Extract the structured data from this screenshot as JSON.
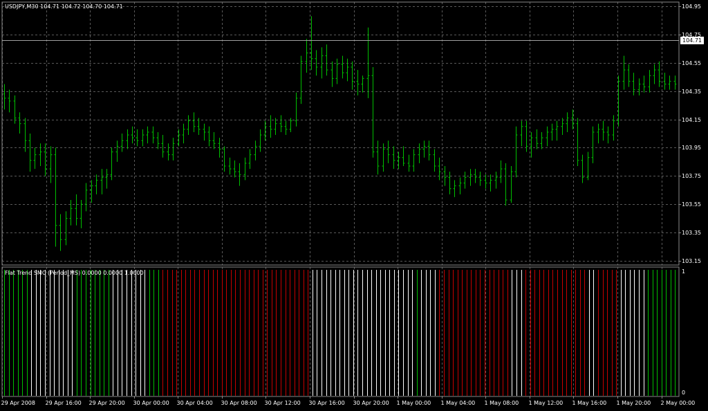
{
  "window": {
    "symbol_info": "USDJPY,M30  104.71 104.72 104.70 104.71",
    "current_price": "104.71"
  },
  "colors": {
    "background": "#000000",
    "grid": "#5a5a5a",
    "candle": "#00c000",
    "hist_green": "#00c000",
    "hist_white": "#ffffff",
    "hist_red": "#c80000",
    "axis": "#8a8a8a"
  },
  "price_axis": {
    "labels": [
      "104.95",
      "104.75",
      "104.55",
      "104.35",
      "104.15",
      "103.95",
      "103.75",
      "103.55",
      "103.35",
      "103.15"
    ],
    "ylim": [
      103.12,
      104.98
    ]
  },
  "time_axis": {
    "labels": [
      "29 Apr 2008",
      "29 Apr 16:00",
      "29 Apr 20:00",
      "30 Apr 00:00",
      "30 Apr 04:00",
      "30 Apr 08:00",
      "30 Apr 12:00",
      "30 Apr 16:00",
      "30 Apr 20:00",
      "1 May 00:00",
      "1 May 04:00",
      "1 May 08:00",
      "1 May 12:00",
      "1 May 16:00",
      "1 May 20:00",
      "2 May 00:00"
    ]
  },
  "indicator": {
    "label": "Flat Trend SMC (Period_MS) 0.0000 0.0000 1.0000",
    "scale_top": "1",
    "scale_bottom": "0",
    "segments": [
      {
        "color": "green",
        "count": 6
      },
      {
        "color": "white",
        "count": 10
      },
      {
        "color": "green",
        "count": 8
      },
      {
        "color": "white",
        "count": 8
      },
      {
        "color": "green",
        "count": 3
      },
      {
        "color": "red",
        "count": 33
      },
      {
        "color": "white",
        "count": 23
      },
      {
        "color": "green",
        "count": 1
      },
      {
        "color": "white",
        "count": 4
      },
      {
        "color": "red",
        "count": 16
      },
      {
        "color": "white",
        "count": 3
      },
      {
        "color": "red",
        "count": 14
      },
      {
        "color": "white",
        "count": 2
      },
      {
        "color": "red",
        "count": 5
      },
      {
        "color": "white",
        "count": 6
      },
      {
        "color": "green",
        "count": 7
      }
    ]
  },
  "chart_data": {
    "type": "ohlc",
    "title": "USDJPY,M30",
    "ylim": [
      103.12,
      104.98
    ],
    "bars": [
      {
        "o": 104.33,
        "h": 104.4,
        "l": 104.22,
        "c": 104.3
      },
      {
        "o": 104.3,
        "h": 104.36,
        "l": 104.2,
        "c": 104.28
      },
      {
        "o": 104.28,
        "h": 104.32,
        "l": 104.12,
        "c": 104.16
      },
      {
        "o": 104.16,
        "h": 104.2,
        "l": 104.05,
        "c": 104.12
      },
      {
        "o": 104.12,
        "h": 104.16,
        "l": 103.92,
        "c": 104.0
      },
      {
        "o": 104.0,
        "h": 104.05,
        "l": 103.78,
        "c": 103.86
      },
      {
        "o": 103.86,
        "h": 103.95,
        "l": 103.8,
        "c": 103.9
      },
      {
        "o": 103.9,
        "h": 103.98,
        "l": 103.82,
        "c": 103.92
      },
      {
        "o": 103.92,
        "h": 103.98,
        "l": 103.75,
        "c": 103.8
      },
      {
        "o": 103.8,
        "h": 103.96,
        "l": 103.7,
        "c": 103.9
      },
      {
        "o": 103.9,
        "h": 103.95,
        "l": 103.25,
        "c": 103.4
      },
      {
        "o": 103.4,
        "h": 103.48,
        "l": 103.22,
        "c": 103.3
      },
      {
        "o": 103.3,
        "h": 103.5,
        "l": 103.26,
        "c": 103.45
      },
      {
        "o": 103.45,
        "h": 103.58,
        "l": 103.4,
        "c": 103.52
      },
      {
        "o": 103.52,
        "h": 103.62,
        "l": 103.4,
        "c": 103.45
      },
      {
        "o": 103.45,
        "h": 103.58,
        "l": 103.38,
        "c": 103.55
      },
      {
        "o": 103.55,
        "h": 103.7,
        "l": 103.5,
        "c": 103.65
      },
      {
        "o": 103.65,
        "h": 103.72,
        "l": 103.56,
        "c": 103.68
      },
      {
        "o": 103.68,
        "h": 103.76,
        "l": 103.62,
        "c": 103.72
      },
      {
        "o": 103.72,
        "h": 103.8,
        "l": 103.62,
        "c": 103.74
      },
      {
        "o": 103.74,
        "h": 103.8,
        "l": 103.66,
        "c": 103.76
      },
      {
        "o": 103.76,
        "h": 103.95,
        "l": 103.72,
        "c": 103.92
      },
      {
        "o": 103.92,
        "h": 104.0,
        "l": 103.85,
        "c": 103.96
      },
      {
        "o": 103.96,
        "h": 104.05,
        "l": 103.92,
        "c": 104.0
      },
      {
        "o": 104.0,
        "h": 104.08,
        "l": 103.94,
        "c": 104.04
      },
      {
        "o": 104.04,
        "h": 104.1,
        "l": 103.98,
        "c": 104.02
      },
      {
        "o": 104.02,
        "h": 104.08,
        "l": 103.96,
        "c": 104.0
      },
      {
        "o": 104.0,
        "h": 104.08,
        "l": 103.96,
        "c": 104.04
      },
      {
        "o": 104.04,
        "h": 104.1,
        "l": 103.98,
        "c": 104.06
      },
      {
        "o": 104.06,
        "h": 104.1,
        "l": 103.98,
        "c": 104.02
      },
      {
        "o": 104.02,
        "h": 104.06,
        "l": 103.94,
        "c": 103.98
      },
      {
        "o": 103.98,
        "h": 104.04,
        "l": 103.88,
        "c": 103.92
      },
      {
        "o": 103.92,
        "h": 103.98,
        "l": 103.86,
        "c": 103.9
      },
      {
        "o": 103.9,
        "h": 104.02,
        "l": 103.86,
        "c": 103.98
      },
      {
        "o": 103.98,
        "h": 104.08,
        "l": 103.96,
        "c": 104.04
      },
      {
        "o": 104.04,
        "h": 104.12,
        "l": 103.98,
        "c": 104.08
      },
      {
        "o": 104.08,
        "h": 104.18,
        "l": 104.04,
        "c": 104.14
      },
      {
        "o": 104.14,
        "h": 104.2,
        "l": 104.06,
        "c": 104.1
      },
      {
        "o": 104.1,
        "h": 104.16,
        "l": 104.04,
        "c": 104.08
      },
      {
        "o": 104.08,
        "h": 104.12,
        "l": 104.0,
        "c": 104.06
      },
      {
        "o": 104.06,
        "h": 104.1,
        "l": 103.96,
        "c": 104.0
      },
      {
        "o": 104.0,
        "h": 104.06,
        "l": 103.94,
        "c": 103.98
      },
      {
        "o": 103.98,
        "h": 104.02,
        "l": 103.88,
        "c": 103.94
      },
      {
        "o": 103.94,
        "h": 103.96,
        "l": 103.78,
        "c": 103.82
      },
      {
        "o": 103.82,
        "h": 103.88,
        "l": 103.76,
        "c": 103.8
      },
      {
        "o": 103.8,
        "h": 103.86,
        "l": 103.74,
        "c": 103.78
      },
      {
        "o": 103.78,
        "h": 103.84,
        "l": 103.68,
        "c": 103.76
      },
      {
        "o": 103.76,
        "h": 103.88,
        "l": 103.72,
        "c": 103.84
      },
      {
        "o": 103.84,
        "h": 103.94,
        "l": 103.8,
        "c": 103.9
      },
      {
        "o": 103.9,
        "h": 104.0,
        "l": 103.86,
        "c": 103.96
      },
      {
        "o": 103.96,
        "h": 104.08,
        "l": 103.92,
        "c": 104.04
      },
      {
        "o": 104.04,
        "h": 104.14,
        "l": 104.0,
        "c": 104.1
      },
      {
        "o": 104.1,
        "h": 104.18,
        "l": 104.02,
        "c": 104.08
      },
      {
        "o": 104.08,
        "h": 104.16,
        "l": 104.04,
        "c": 104.12
      },
      {
        "o": 104.12,
        "h": 104.18,
        "l": 104.06,
        "c": 104.1
      },
      {
        "o": 104.1,
        "h": 104.14,
        "l": 104.04,
        "c": 104.08
      },
      {
        "o": 104.08,
        "h": 104.16,
        "l": 104.06,
        "c": 104.14
      },
      {
        "o": 104.14,
        "h": 104.34,
        "l": 104.1,
        "c": 104.3
      },
      {
        "o": 104.3,
        "h": 104.6,
        "l": 104.26,
        "c": 104.56
      },
      {
        "o": 104.56,
        "h": 104.72,
        "l": 104.48,
        "c": 104.62
      },
      {
        "o": 104.62,
        "h": 104.88,
        "l": 104.5,
        "c": 104.58
      },
      {
        "o": 104.58,
        "h": 104.64,
        "l": 104.46,
        "c": 104.52
      },
      {
        "o": 104.52,
        "h": 104.66,
        "l": 104.44,
        "c": 104.6
      },
      {
        "o": 104.6,
        "h": 104.68,
        "l": 104.46,
        "c": 104.5
      },
      {
        "o": 104.5,
        "h": 104.56,
        "l": 104.38,
        "c": 104.44
      },
      {
        "o": 104.44,
        "h": 104.58,
        "l": 104.4,
        "c": 104.54
      },
      {
        "o": 104.54,
        "h": 104.6,
        "l": 104.44,
        "c": 104.48
      },
      {
        "o": 104.48,
        "h": 104.58,
        "l": 104.42,
        "c": 104.52
      },
      {
        "o": 104.52,
        "h": 104.56,
        "l": 104.36,
        "c": 104.42
      },
      {
        "o": 104.42,
        "h": 104.5,
        "l": 104.32,
        "c": 104.4
      },
      {
        "o": 104.4,
        "h": 104.46,
        "l": 104.34,
        "c": 104.44
      },
      {
        "o": 104.44,
        "h": 104.8,
        "l": 104.3,
        "c": 104.46
      },
      {
        "o": 104.46,
        "h": 104.52,
        "l": 103.88,
        "c": 103.92
      },
      {
        "o": 103.92,
        "h": 104.0,
        "l": 103.76,
        "c": 103.82
      },
      {
        "o": 103.82,
        "h": 103.98,
        "l": 103.78,
        "c": 103.94
      },
      {
        "o": 103.94,
        "h": 104.0,
        "l": 103.84,
        "c": 103.9
      },
      {
        "o": 103.9,
        "h": 103.96,
        "l": 103.8,
        "c": 103.86
      },
      {
        "o": 103.86,
        "h": 103.92,
        "l": 103.8,
        "c": 103.88
      },
      {
        "o": 103.88,
        "h": 103.96,
        "l": 103.82,
        "c": 103.84
      },
      {
        "o": 103.84,
        "h": 103.9,
        "l": 103.78,
        "c": 103.82
      },
      {
        "o": 103.82,
        "h": 103.94,
        "l": 103.78,
        "c": 103.9
      },
      {
        "o": 103.9,
        "h": 103.98,
        "l": 103.84,
        "c": 103.94
      },
      {
        "o": 103.94,
        "h": 104.0,
        "l": 103.88,
        "c": 103.96
      },
      {
        "o": 103.96,
        "h": 104.0,
        "l": 103.86,
        "c": 103.9
      },
      {
        "o": 103.9,
        "h": 103.94,
        "l": 103.78,
        "c": 103.82
      },
      {
        "o": 103.82,
        "h": 103.88,
        "l": 103.72,
        "c": 103.78
      },
      {
        "o": 103.78,
        "h": 103.82,
        "l": 103.68,
        "c": 103.74
      },
      {
        "o": 103.74,
        "h": 103.78,
        "l": 103.62,
        "c": 103.66
      },
      {
        "o": 103.66,
        "h": 103.72,
        "l": 103.6,
        "c": 103.68
      },
      {
        "o": 103.68,
        "h": 103.74,
        "l": 103.62,
        "c": 103.7
      },
      {
        "o": 103.7,
        "h": 103.78,
        "l": 103.66,
        "c": 103.74
      },
      {
        "o": 103.74,
        "h": 103.8,
        "l": 103.68,
        "c": 103.76
      },
      {
        "o": 103.76,
        "h": 103.8,
        "l": 103.7,
        "c": 103.74
      },
      {
        "o": 103.74,
        "h": 103.78,
        "l": 103.68,
        "c": 103.72
      },
      {
        "o": 103.72,
        "h": 103.76,
        "l": 103.66,
        "c": 103.7
      },
      {
        "o": 103.7,
        "h": 103.76,
        "l": 103.64,
        "c": 103.72
      },
      {
        "o": 103.72,
        "h": 103.78,
        "l": 103.66,
        "c": 103.74
      },
      {
        "o": 103.74,
        "h": 103.86,
        "l": 103.7,
        "c": 103.8
      },
      {
        "o": 103.8,
        "h": 103.84,
        "l": 103.54,
        "c": 103.58
      },
      {
        "o": 103.58,
        "h": 103.82,
        "l": 103.56,
        "c": 103.78
      },
      {
        "o": 103.78,
        "h": 104.1,
        "l": 103.74,
        "c": 104.04
      },
      {
        "o": 104.04,
        "h": 104.14,
        "l": 103.96,
        "c": 104.1
      },
      {
        "o": 104.1,
        "h": 104.14,
        "l": 103.92,
        "c": 103.96
      },
      {
        "o": 103.96,
        "h": 104.06,
        "l": 103.88,
        "c": 104.02
      },
      {
        "o": 104.02,
        "h": 104.08,
        "l": 103.94,
        "c": 103.98
      },
      {
        "o": 103.98,
        "h": 104.06,
        "l": 103.94,
        "c": 104.02
      },
      {
        "o": 104.02,
        "h": 104.1,
        "l": 103.96,
        "c": 104.06
      },
      {
        "o": 104.06,
        "h": 104.12,
        "l": 104.0,
        "c": 104.08
      },
      {
        "o": 104.08,
        "h": 104.14,
        "l": 104.0,
        "c": 104.1
      },
      {
        "o": 104.1,
        "h": 104.16,
        "l": 104.04,
        "c": 104.12
      },
      {
        "o": 104.12,
        "h": 104.2,
        "l": 104.06,
        "c": 104.16
      },
      {
        "o": 104.16,
        "h": 104.22,
        "l": 104.08,
        "c": 104.12
      },
      {
        "o": 104.12,
        "h": 104.16,
        "l": 103.82,
        "c": 103.86
      },
      {
        "o": 103.86,
        "h": 103.9,
        "l": 103.7,
        "c": 103.74
      },
      {
        "o": 103.74,
        "h": 103.92,
        "l": 103.72,
        "c": 103.88
      },
      {
        "o": 103.88,
        "h": 104.1,
        "l": 103.84,
        "c": 104.06
      },
      {
        "o": 104.06,
        "h": 104.12,
        "l": 103.98,
        "c": 104.08
      },
      {
        "o": 104.08,
        "h": 104.14,
        "l": 104.0,
        "c": 104.06
      },
      {
        "o": 104.06,
        "h": 104.1,
        "l": 103.98,
        "c": 104.04
      },
      {
        "o": 104.04,
        "h": 104.18,
        "l": 104.0,
        "c": 104.14
      },
      {
        "o": 104.14,
        "h": 104.46,
        "l": 104.1,
        "c": 104.42
      },
      {
        "o": 104.42,
        "h": 104.6,
        "l": 104.36,
        "c": 104.5
      },
      {
        "o": 104.5,
        "h": 104.54,
        "l": 104.38,
        "c": 104.42
      },
      {
        "o": 104.42,
        "h": 104.48,
        "l": 104.32,
        "c": 104.36
      },
      {
        "o": 104.36,
        "h": 104.44,
        "l": 104.32,
        "c": 104.4
      },
      {
        "o": 104.4,
        "h": 104.46,
        "l": 104.34,
        "c": 104.38
      },
      {
        "o": 104.38,
        "h": 104.5,
        "l": 104.34,
        "c": 104.46
      },
      {
        "o": 104.46,
        "h": 104.54,
        "l": 104.4,
        "c": 104.5
      },
      {
        "o": 104.5,
        "h": 104.56,
        "l": 104.38,
        "c": 104.42
      },
      {
        "o": 104.42,
        "h": 104.48,
        "l": 104.36,
        "c": 104.4
      },
      {
        "o": 104.4,
        "h": 104.46,
        "l": 104.36,
        "c": 104.42
      },
      {
        "o": 104.42,
        "h": 104.46,
        "l": 104.36,
        "c": 104.4
      }
    ]
  }
}
